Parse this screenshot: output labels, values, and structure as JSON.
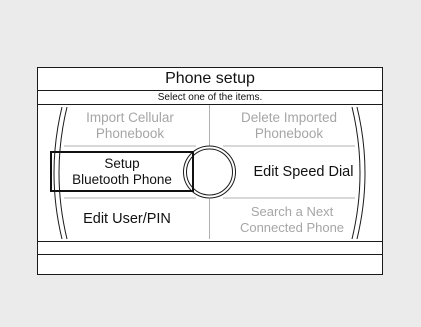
{
  "header": {
    "title": "Phone setup",
    "subtitle": "Select one of the items."
  },
  "menu": {
    "import_cellular": {
      "line1": "Import Cellular",
      "line2": "Phonebook",
      "state": "disabled"
    },
    "delete_imported": {
      "line1": "Delete Imported",
      "line2": "Phonebook",
      "state": "disabled"
    },
    "setup_bluetooth": {
      "line1": "Setup",
      "line2": "Bluetooth Phone",
      "state": "selected"
    },
    "edit_speed_dial": {
      "label": "Edit Speed Dial",
      "state": "enabled"
    },
    "edit_user_pin": {
      "label": "Edit User/PIN",
      "state": "enabled"
    },
    "search_next": {
      "line1": "Search a Next",
      "line2": "Connected Phone",
      "state": "disabled"
    }
  },
  "colors": {
    "background": "#ebebeb",
    "screen": "#ffffff",
    "text": "#111111",
    "disabled_text": "#a6a6a6"
  }
}
